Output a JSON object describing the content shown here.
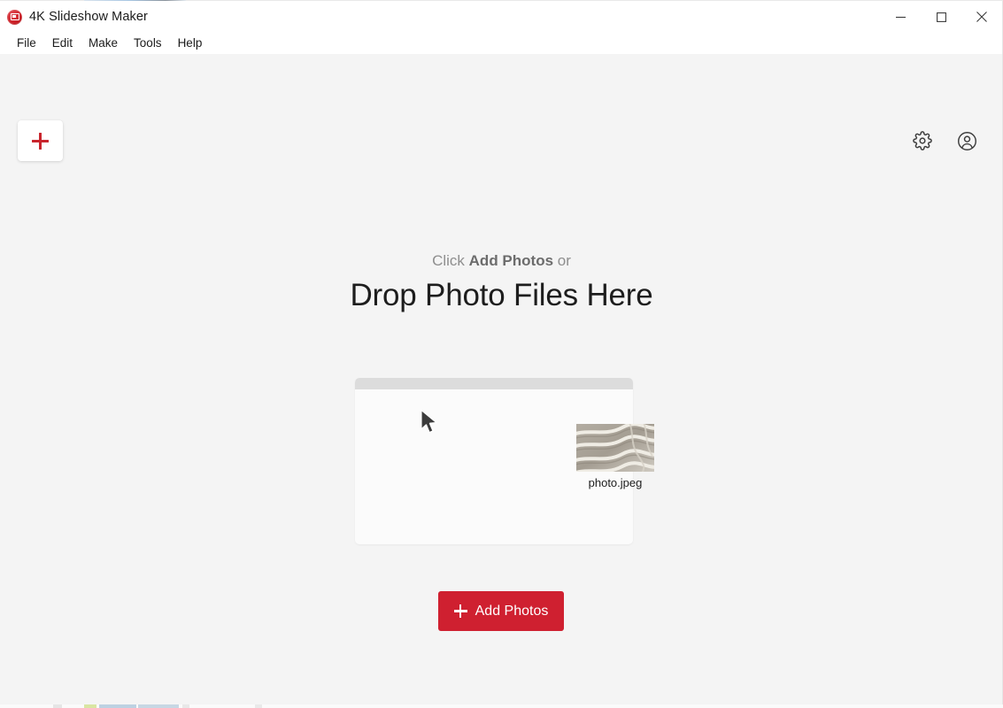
{
  "window": {
    "title": "4K Slideshow Maker",
    "app_icon": "slideshow-app-icon",
    "controls": {
      "minimize": "minimize-icon",
      "maximize": "maximize-icon",
      "close": "close-icon"
    }
  },
  "menubar": {
    "items": [
      {
        "label": "File"
      },
      {
        "label": "Edit"
      },
      {
        "label": "Make"
      },
      {
        "label": "Tools"
      },
      {
        "label": "Help"
      }
    ]
  },
  "toolbar": {
    "add_card_icon": "plus-icon",
    "settings_icon": "gear-icon",
    "account_icon": "account-circle-icon"
  },
  "dropzone": {
    "sub_prefix": "Click ",
    "sub_emphasis": "Add Photos",
    "sub_suffix": " or",
    "headline": "Drop Photo Files Here",
    "illustration": {
      "window_label": "fake-window-illustration",
      "dragged_file_name": "photo.jpeg",
      "cursor_icon": "arrow-cursor-icon"
    }
  },
  "primary_button": {
    "label": "Add Photos",
    "icon": "plus-icon"
  },
  "colors": {
    "brand_red": "#cf2030",
    "accent_plus_red": "#c9252d",
    "content_bg": "#f4f4f4",
    "chrome_bg": "#ffffff",
    "headline": "#1d1d1d",
    "subtext": "#8e8e8e",
    "subtext_strong": "#6c6c6c",
    "illus_titlebar": "#dcdcdc"
  }
}
